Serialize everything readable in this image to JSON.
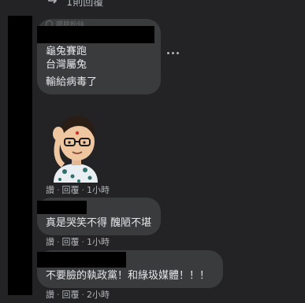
{
  "thread": {
    "reply_count_label": "1則回覆"
  },
  "comments": [
    {
      "author_hint": "哪臉粉絲",
      "lines": [
        "龜兔賽跑",
        "台灣屬兔",
        "輸給病毒了"
      ],
      "has_sticker": true,
      "actions": {
        "like": "讚",
        "reply": "回覆",
        "time": "1小時"
      }
    },
    {
      "lines": [
        "真是哭笑不得 醜陋不堪"
      ],
      "actions": {
        "like": "讚",
        "reply": "回覆",
        "time": "1小時"
      }
    },
    {
      "lines": [
        "不要臉的執政黨！和綠圾媒體！！！"
      ],
      "actions": {
        "like": "讚",
        "reply": "回覆",
        "time": "2小時"
      }
    }
  ],
  "icons": {
    "reply_arrow": "reply-arrow-icon",
    "more": "more-options-icon",
    "sticker": "memoji-sticker"
  },
  "colors": {
    "background": "#232325",
    "bubble": "#3a3b3c",
    "text": "#e4e6eb",
    "secondary_text": "#b0b3b8",
    "redaction": "#000000"
  }
}
